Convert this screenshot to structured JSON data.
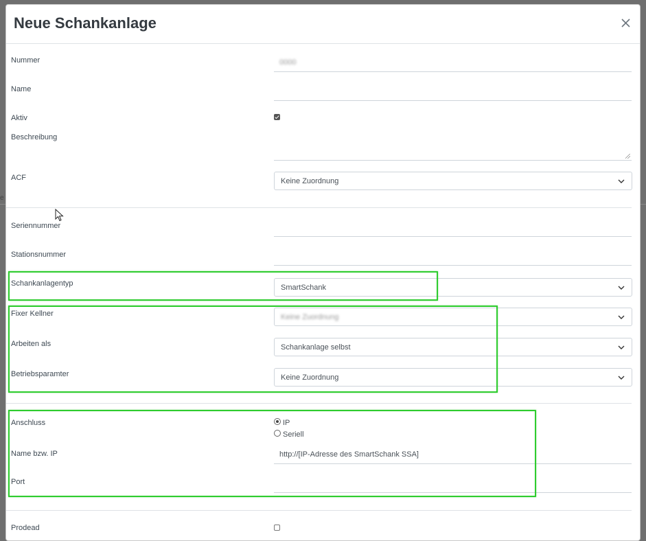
{
  "modal": {
    "title": "Neue Schankanlage",
    "close_label": "×"
  },
  "fields": {
    "nummer": {
      "label": "Nummer",
      "value": "0000"
    },
    "name": {
      "label": "Name",
      "value": ""
    },
    "aktiv": {
      "label": "Aktiv",
      "checked": true
    },
    "beschreibung": {
      "label": "Beschreibung",
      "value": ""
    },
    "acf": {
      "label": "ACF",
      "value": "Keine Zuordnung"
    },
    "seriennummer": {
      "label": "Seriennummer",
      "value": ""
    },
    "stationsnummer": {
      "label": "Stationsnummer",
      "value": ""
    },
    "schankanlagentyp": {
      "label": "Schankanlagentyp",
      "value": "SmartSchank"
    },
    "fixer_kellner": {
      "label": "Fixer Kellner",
      "value": "Keine Zuordnung"
    },
    "arbeiten_als": {
      "label": "Arbeiten als",
      "value": "Schankanlage selbst"
    },
    "betriebsparamter": {
      "label": "Betriebsparamter",
      "value": "Keine Zuordnung"
    },
    "anschluss": {
      "label": "Anschluss",
      "options": [
        "IP",
        "Seriell"
      ],
      "selected": "IP"
    },
    "name_ip": {
      "label": "Name bzw. IP",
      "value": "http://[IP-Adresse des SmartSchank SSA]"
    },
    "port": {
      "label": "Port",
      "value": ""
    },
    "bottom": {
      "label": "Prodead"
    }
  },
  "side_fragment": "e",
  "colors": {
    "highlight": "#2ecc2e",
    "backdrop": "#6f6f6f"
  }
}
